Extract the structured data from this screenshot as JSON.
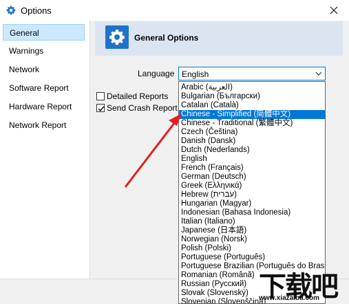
{
  "window": {
    "title": "Options"
  },
  "sidebar": {
    "items": [
      {
        "label": "General",
        "selected": true
      },
      {
        "label": "Warnings"
      },
      {
        "label": "Network"
      },
      {
        "label": "Software Report"
      },
      {
        "label": "Hardware Report"
      },
      {
        "label": "Network Report"
      }
    ]
  },
  "header": {
    "title": "General Options"
  },
  "language": {
    "label": "Language",
    "selected": "English",
    "options": [
      "Arabic (العربية)",
      "Bulgarian (Български)",
      "Catalan (Català)",
      "Chinese - Simplified (简體中文)",
      "Chinese - Traditional (繁體中文)",
      "Czech (Čeština)",
      "Danish (Dansk)",
      "Dutch (Nederlands)",
      "English",
      "French (Français)",
      "German (Deutsch)",
      "Greek (Ελληνικά)",
      "Hebrew (עברית)",
      "Hungarian (Magyar)",
      "Indonesian (Bahasa Indonesia)",
      "Italian (Italiano)",
      "Japanese (日本語)",
      "Norwegian (Norsk)",
      "Polish (Polski)",
      "Portuguese (Português)",
      "Portuguese Brazilian (Português do Brasil)",
      "Romanian (Română)",
      "Russian (Русский)",
      "Slovak (Slovenský)",
      "Slovenian (Slovenščina)"
    ],
    "highlighted": "Chinese - Simplified (简體中文)"
  },
  "checkboxes": [
    {
      "label": "Detailed Reports",
      "checked": false
    },
    {
      "label": "Send Crash Report",
      "checked": true
    }
  ],
  "watermark": {
    "big": "下载吧",
    "small": "www.xiazaiba.com"
  },
  "colors": {
    "accent": "#0078d7",
    "selection": "#cce8ff",
    "header_band": "#dbe5f1",
    "arrow": "#e02020"
  }
}
